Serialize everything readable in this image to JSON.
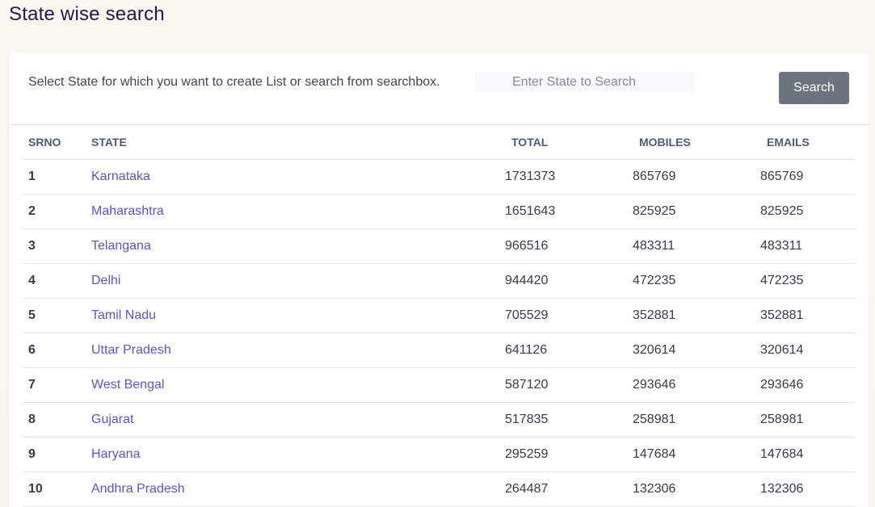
{
  "page": {
    "title": "State wise search"
  },
  "search": {
    "prompt": "Select State for which you want to create List or search from searchbox.",
    "placeholder": "Enter State to Search",
    "value": "",
    "button_label": "Search"
  },
  "table": {
    "headers": {
      "srno": "SRNO",
      "state": "STATE",
      "total": "TOTAL",
      "mobiles": "MOBILES",
      "emails": "EMAILS"
    },
    "rows": [
      {
        "srno": "1",
        "state": "Karnataka",
        "total": "1731373",
        "mobiles": "865769",
        "emails": "865769"
      },
      {
        "srno": "2",
        "state": "Maharashtra",
        "total": "1651643",
        "mobiles": "825925",
        "emails": "825925"
      },
      {
        "srno": "3",
        "state": "Telangana",
        "total": "966516",
        "mobiles": "483311",
        "emails": "483311"
      },
      {
        "srno": "4",
        "state": "Delhi",
        "total": "944420",
        "mobiles": "472235",
        "emails": "472235"
      },
      {
        "srno": "5",
        "state": "Tamil Nadu",
        "total": "705529",
        "mobiles": "352881",
        "emails": "352881"
      },
      {
        "srno": "6",
        "state": "Uttar Pradesh",
        "total": "641126",
        "mobiles": "320614",
        "emails": "320614"
      },
      {
        "srno": "7",
        "state": "West Bengal",
        "total": "587120",
        "mobiles": "293646",
        "emails": "293646"
      },
      {
        "srno": "8",
        "state": "Gujarat",
        "total": "517835",
        "mobiles": "258981",
        "emails": "258981"
      },
      {
        "srno": "9",
        "state": "Haryana",
        "total": "295259",
        "mobiles": "147684",
        "emails": "147684"
      },
      {
        "srno": "10",
        "state": "Andhra Pradesh",
        "total": "264487",
        "mobiles": "132306",
        "emails": "132306"
      }
    ]
  },
  "colors": {
    "title": "#1e1a4a",
    "link": "#5b54c9",
    "button": "#6c757d",
    "header_text": "#505a78"
  }
}
